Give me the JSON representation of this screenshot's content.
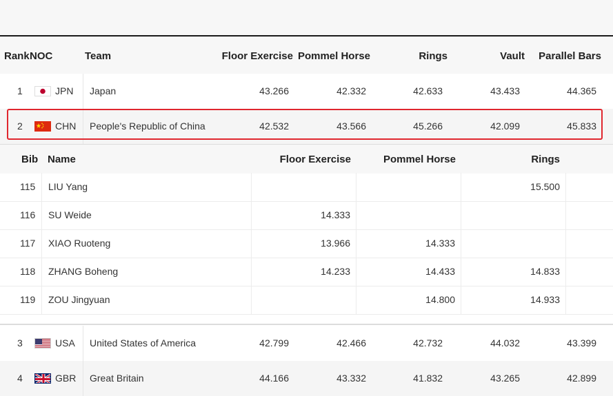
{
  "header": {
    "rank": "Rank",
    "noc": "NOC",
    "team": "Team",
    "floor": "Floor Exercise",
    "pommel": "Pommel Horse",
    "rings": "Rings",
    "vault": "Vault",
    "parallel": "Parallel Bars"
  },
  "teams": [
    {
      "rank": "1",
      "noc": "JPN",
      "team": "Japan",
      "floor": "43.266",
      "pommel": "42.332",
      "rings": "42.633",
      "vault": "43.433",
      "parallel": "44.365"
    },
    {
      "rank": "2",
      "noc": "CHN",
      "team": "People's Republic of China",
      "floor": "42.532",
      "pommel": "43.566",
      "rings": "45.266",
      "vault": "42.099",
      "parallel": "45.833"
    },
    {
      "rank": "3",
      "noc": "USA",
      "team": "United States of America",
      "floor": "42.799",
      "pommel": "42.466",
      "rings": "42.732",
      "vault": "44.032",
      "parallel": "43.399"
    },
    {
      "rank": "4",
      "noc": "GBR",
      "team": "Great Britain",
      "floor": "44.166",
      "pommel": "43.332",
      "rings": "41.832",
      "vault": "43.265",
      "parallel": "42.899"
    }
  ],
  "athlete_header": {
    "bib": "Bib",
    "name": "Name",
    "floor": "Floor Exercise",
    "pommel": "Pommel Horse",
    "rings": "Rings"
  },
  "athletes": [
    {
      "bib": "115",
      "name": "LIU Yang",
      "floor": "",
      "pommel": "",
      "rings": "15.500"
    },
    {
      "bib": "116",
      "name": "SU Weide",
      "floor": "14.333",
      "pommel": "",
      "rings": ""
    },
    {
      "bib": "117",
      "name": "XIAO Ruoteng",
      "floor": "13.966",
      "pommel": "14.333",
      "rings": ""
    },
    {
      "bib": "118",
      "name": "ZHANG Boheng",
      "floor": "14.233",
      "pommel": "14.433",
      "rings": "14.833"
    },
    {
      "bib": "119",
      "name": "ZOU Jingyuan",
      "floor": "",
      "pommel": "14.800",
      "rings": "14.933"
    }
  ],
  "colors": {
    "highlight": "#e0262e",
    "japan_red": "#bc002d",
    "china_red": "#de2910",
    "china_star": "#ffde00",
    "usa_red": "#b22234",
    "usa_blue": "#3c3b6e",
    "gbr_blue": "#012169",
    "gbr_red": "#c8102e"
  },
  "icons": {
    "jpn": "japan-flag-icon",
    "chn": "china-flag-icon",
    "usa": "usa-flag-icon",
    "gbr": "uk-flag-icon"
  }
}
